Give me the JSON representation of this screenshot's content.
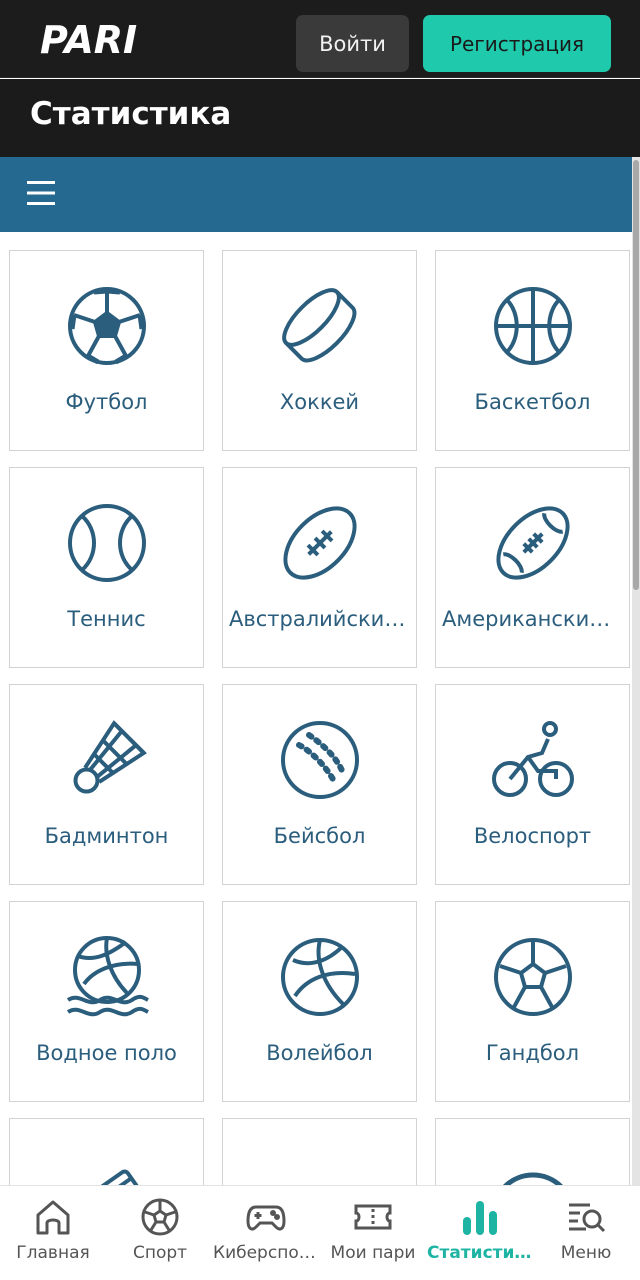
{
  "header": {
    "logo_text": "PARI",
    "login_label": "Войти",
    "register_label": "Регистрация"
  },
  "page": {
    "title": "Статистика"
  },
  "sports": [
    {
      "label": "Футбол",
      "icon": "football-icon"
    },
    {
      "label": "Хоккей",
      "icon": "hockey-puck-icon"
    },
    {
      "label": "Баскетбол",
      "icon": "basketball-icon"
    },
    {
      "label": "Теннис",
      "icon": "tennis-ball-icon"
    },
    {
      "label": "Австралийский футбол",
      "icon": "rugby-ball-icon"
    },
    {
      "label": "Американский футбол",
      "icon": "american-football-icon"
    },
    {
      "label": "Бадминтон",
      "icon": "shuttlecock-icon"
    },
    {
      "label": "Бейсбол",
      "icon": "baseball-icon"
    },
    {
      "label": "Велоспорт",
      "icon": "cyclist-icon"
    },
    {
      "label": "Водное поло",
      "icon": "water-polo-icon"
    },
    {
      "label": "Волейбол",
      "icon": "volleyball-icon"
    },
    {
      "label": "Гандбол",
      "icon": "handball-icon"
    }
  ],
  "bottom_nav": [
    {
      "label": "Главная",
      "icon": "home-icon"
    },
    {
      "label": "Спорт",
      "icon": "ball-icon"
    },
    {
      "label": "Киберспорт",
      "icon": "gamepad-icon"
    },
    {
      "label": "Мои пари",
      "icon": "ticket-icon"
    },
    {
      "label": "Статистика",
      "icon": "stats-icon",
      "active": true
    },
    {
      "label": "Меню",
      "icon": "menu-search-icon"
    }
  ],
  "colors": {
    "accent": "#1fc9ac",
    "brand_blue": "#266990",
    "icon": "#2b5d7d",
    "dark": "#1b1b1b"
  }
}
